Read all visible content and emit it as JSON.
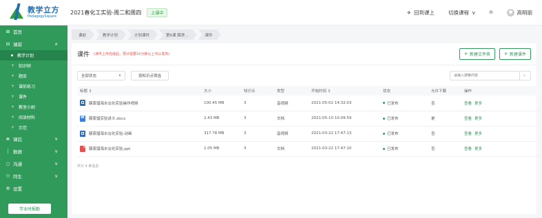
{
  "header": {
    "logo_cn": "教学立方",
    "logo_en": "PedagogySquare",
    "course_title": "2021春化工实验-周二和周四",
    "status_tag": "上课中",
    "back_to_class": "回到课上",
    "switch_course": "切换课程",
    "user_name": "高明丽"
  },
  "sidebar": {
    "items": [
      {
        "label": "首页",
        "icon": "grid-icon"
      },
      {
        "label": "课前",
        "icon": "list-icon"
      }
    ],
    "sub_items": [
      {
        "label": "教学计划"
      },
      {
        "label": "知识树"
      },
      {
        "label": "题库"
      },
      {
        "label": "课前练习"
      },
      {
        "label": "课件"
      },
      {
        "label": "教室小剧"
      },
      {
        "label": "阅读材料"
      },
      {
        "label": "示范"
      }
    ],
    "bottom_items": [
      {
        "label": "课后",
        "icon": "doc-icon"
      },
      {
        "label": "数据",
        "icon": "chart-icon"
      },
      {
        "label": "沟通",
        "icon": "chat-icon"
      },
      {
        "label": "同生",
        "icon": "people-icon"
      },
      {
        "label": "设置",
        "icon": "gear-icon"
      }
    ],
    "bottom_button": "学业时报勤"
  },
  "breadcrumbs": [
    "课前",
    "教学计划",
    "计划课时",
    "第6课 膜渗...",
    "课件"
  ],
  "panel": {
    "title": "课件",
    "note": "(课件上传完成后，预计需要10分钟以上可以发布)",
    "new_folder": "新建文件夹",
    "new_courseware": "新建课件",
    "filter_select": "全部状态",
    "filter_button": "按知识点筛选",
    "search_placeholder": "请输入搜索内容",
    "total": "共计 4 条信息"
  },
  "table": {
    "headers": [
      "标题 ↕",
      "大小",
      "知识点",
      "类型",
      "开始时间 ↕",
      "状态",
      "允许下载",
      "操作"
    ],
    "rows": [
      {
        "icon": "video",
        "title": "膜蒸馏海水淡化实验操作视频",
        "size": "100.45 MB",
        "kp": "3",
        "type": "音视频",
        "time": "2021-05-02 14:32:03",
        "status": "已发布",
        "download": "否",
        "op1": "查看",
        "op2": "更多"
      },
      {
        "icon": "doc",
        "title": "膜蒸馏实验讲义.docx",
        "size": "2.43 MB",
        "kp": "3",
        "type": "文档",
        "time": "2021-05-10 10:09:59",
        "status": "已发布",
        "download": "是",
        "op1": "查看",
        "op2": "更多"
      },
      {
        "icon": "video",
        "title": "膜蒸馏海水淡化实验-动画",
        "size": "317.78 MB",
        "kp": "3",
        "type": "音视频",
        "time": "2021-03-22 17:47:13",
        "status": "已发布",
        "download": "否",
        "op1": "查看",
        "op2": "更多"
      },
      {
        "icon": "ppt",
        "title": "膜蒸馏海水淡化实验.ppt",
        "size": "1.05 MB",
        "kp": "3",
        "type": "文档",
        "time": "2021-03-22 17:47:10",
        "status": "已发布",
        "download": "否",
        "op1": "查看",
        "op2": "更多"
      }
    ]
  }
}
